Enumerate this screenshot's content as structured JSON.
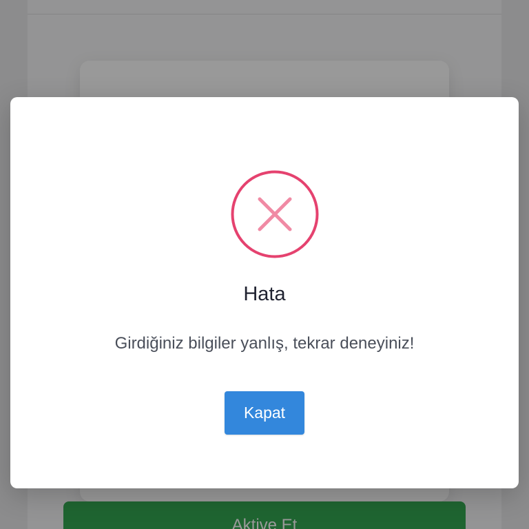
{
  "background": {
    "activate_label": "Aktive Et",
    "activate_color": "#34a853"
  },
  "dialog": {
    "icon": "error-x-circle-icon",
    "icon_color": "#e5426f",
    "title": "Hata",
    "message": "Girdiğiniz bilgiler yanlış, tekrar deneyiniz!",
    "close_label": "Kapat",
    "close_color": "#3387dc"
  }
}
